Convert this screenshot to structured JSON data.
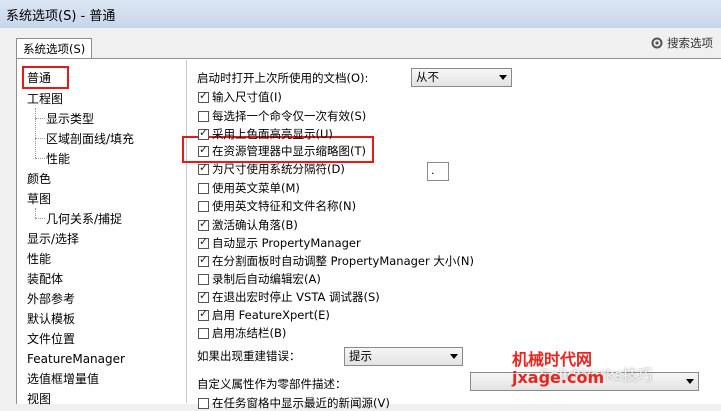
{
  "window": {
    "title": "系统选项(S) - 普通"
  },
  "tab": {
    "label": "系统选项(S)"
  },
  "search": {
    "label": "搜索选项"
  },
  "tree": {
    "items": [
      {
        "label": "普通"
      },
      {
        "label": "工程图"
      },
      {
        "label": "显示类型"
      },
      {
        "label": "区域剖面线/填充"
      },
      {
        "label": "性能"
      },
      {
        "label": "颜色"
      },
      {
        "label": "草图"
      },
      {
        "label": "几何关系/捕捉"
      },
      {
        "label": "显示/选择"
      },
      {
        "label": "性能"
      },
      {
        "label": "装配体"
      },
      {
        "label": "外部参考"
      },
      {
        "label": "默认模板"
      },
      {
        "label": "文件位置"
      },
      {
        "label": "FeatureManager"
      },
      {
        "label": "选值框增量值"
      },
      {
        "label": "视图"
      }
    ]
  },
  "settings": {
    "open_docs_label": "启动时打开上次所使用的文档(O):",
    "open_docs_value": "从不",
    "options": [
      {
        "label": "输入尺寸值(I)",
        "checked": true
      },
      {
        "label": "每选择一个命令仅一次有效(S)",
        "checked": false
      },
      {
        "label": "采用上色面高亮显示(U)",
        "checked": true
      },
      {
        "label": "在资源管理器中显示缩略图(T)",
        "checked": true
      },
      {
        "label": "为尺寸使用系统分隔符(D)",
        "checked": true
      },
      {
        "label": "使用英文菜单(M)",
        "checked": false
      },
      {
        "label": "使用英文特征和文件名称(N)",
        "checked": false
      },
      {
        "label": "激活确认角落(B)",
        "checked": true
      },
      {
        "label": "自动显示 PropertyManager",
        "checked": true
      },
      {
        "label": "在分割面板时自动调整 PropertyManager 大小(N)",
        "checked": true
      },
      {
        "label": "录制后自动编辑宏(A)",
        "checked": false
      },
      {
        "label": "在退出宏时停止 VSTA 调试器(S)",
        "checked": true
      },
      {
        "label": "启用 FeatureXpert(E)",
        "checked": true
      },
      {
        "label": "启用冻结栏(B)",
        "checked": false
      }
    ],
    "separator_value": ".",
    "rebuild_error_label": "如果出现重建错误：",
    "rebuild_error_value": "提示",
    "custom_prop_label": "自定义属性作为零部件描述：",
    "custom_prop_value": "",
    "last_option_label": "在任务窗格中显示最近的新闻源(V)"
  },
  "watermark": {
    "line1": "机械时代网",
    "line2": "SolidWorks技巧",
    "line3": "jxage.com"
  },
  "colors": {
    "highlight": "#e21b1b"
  }
}
